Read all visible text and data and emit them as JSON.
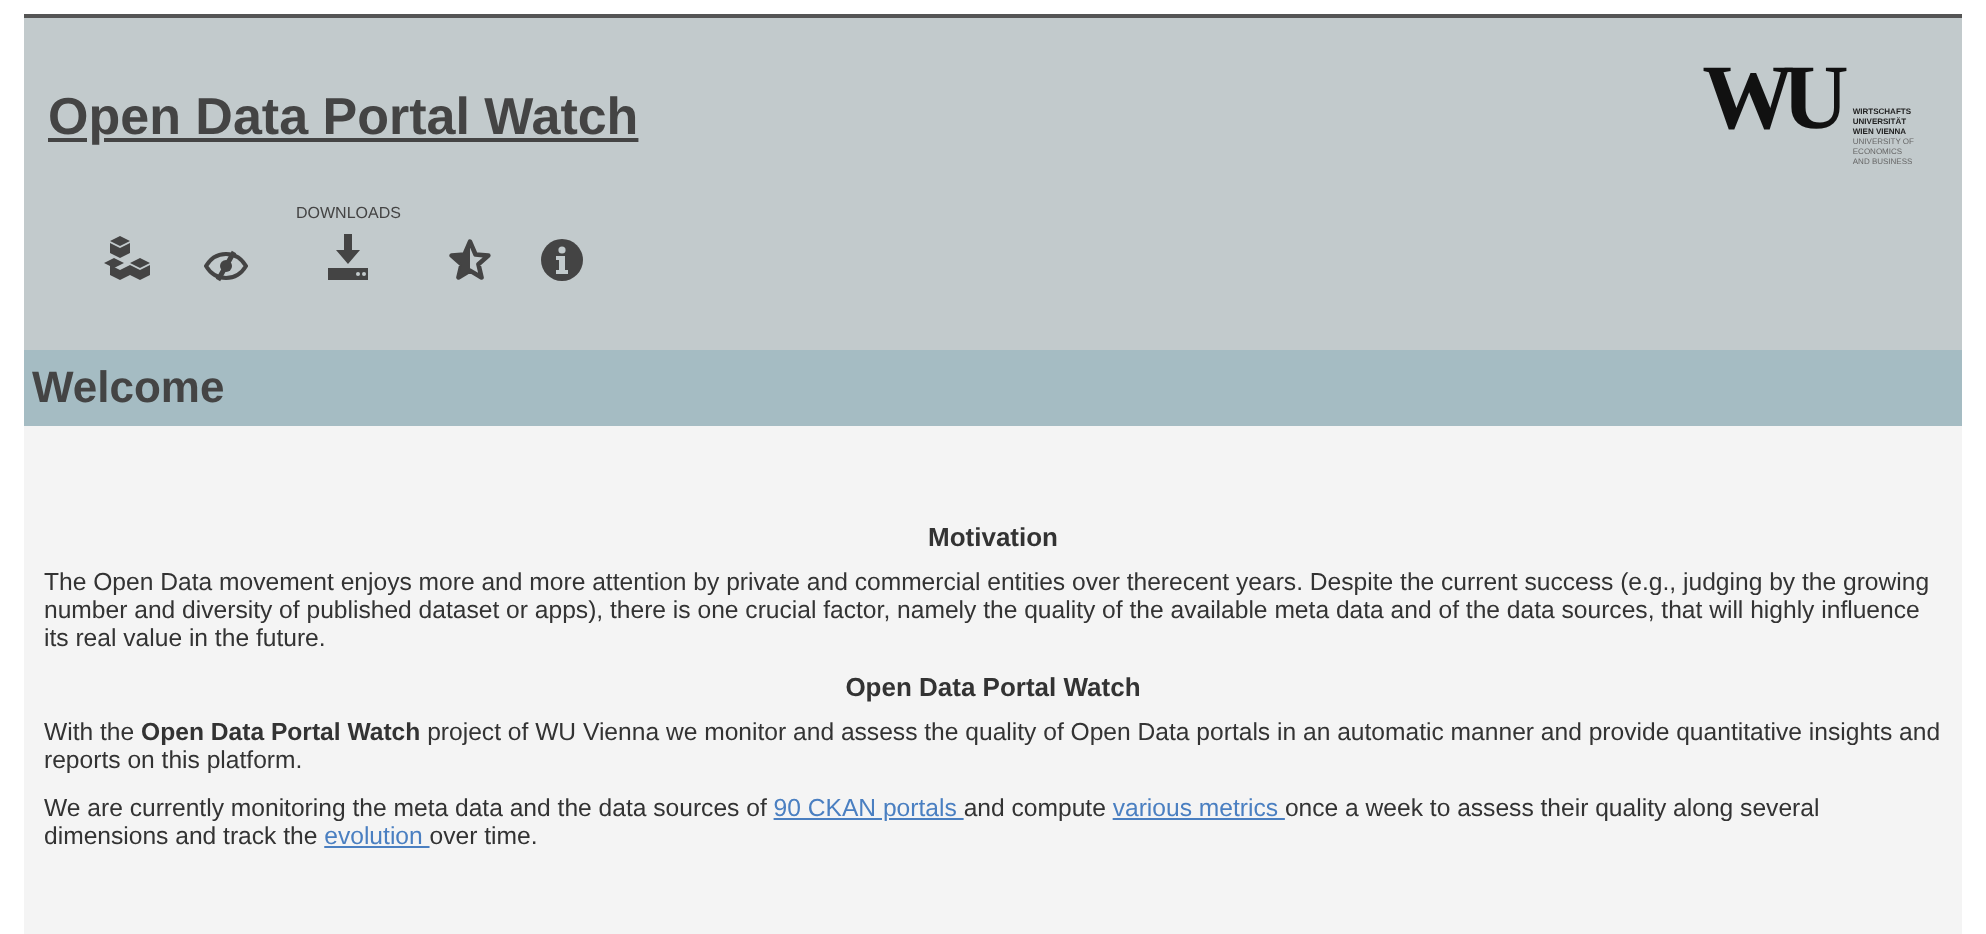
{
  "header": {
    "title": "Open Data Portal Watch",
    "logo": {
      "mark": "WU",
      "lines": [
        "WIRTSCHAFTS",
        "UNIVERSITÄT",
        "WIEN VIENNA",
        "UNIVERSITY OF",
        "ECONOMICS",
        "AND BUSINESS"
      ]
    },
    "nav": [
      {
        "kind": "cubes"
      },
      {
        "kind": "eye-slash"
      },
      {
        "kind": "download",
        "label": "DOWNLOADS"
      },
      {
        "kind": "star-half"
      },
      {
        "kind": "info"
      }
    ]
  },
  "section": {
    "title": "Welcome"
  },
  "content": [
    {
      "kind": "heading",
      "text": "Motivation"
    },
    {
      "kind": "paragraph",
      "parts": [
        {
          "kind": "text",
          "text": "The Open Data movement enjoys more and more attention by private and commercial entities over therecent years. Despite the current success (e.g., judging by the growing number and diversity of published dataset or apps), there is one crucial factor, namely the quality of the available meta data and of the data sources, that will highly influence its real value in the future."
        }
      ]
    },
    {
      "kind": "heading",
      "text": "Open Data Portal Watch"
    },
    {
      "kind": "paragraph",
      "parts": [
        {
          "kind": "text",
          "text": "With the "
        },
        {
          "kind": "bold",
          "text": "Open Data Portal Watch"
        },
        {
          "kind": "text",
          "text": " project of WU Vienna we monitor and assess the quality of Open Data portals in an automatic manner and provide quantitative insights and reports on this platform."
        }
      ]
    },
    {
      "kind": "paragraph",
      "parts": [
        {
          "kind": "text",
          "text": "We are currently monitoring the meta data and the data sources of "
        },
        {
          "kind": "link",
          "text": "90 CKAN portals "
        },
        {
          "kind": "text",
          "text": "and compute "
        },
        {
          "kind": "link",
          "text": "various metrics "
        },
        {
          "kind": "text",
          "text": "once a week to assess their quality along several dimensions and track the "
        },
        {
          "kind": "link",
          "text": "evolution "
        },
        {
          "kind": "text",
          "text": "over time."
        }
      ]
    }
  ]
}
